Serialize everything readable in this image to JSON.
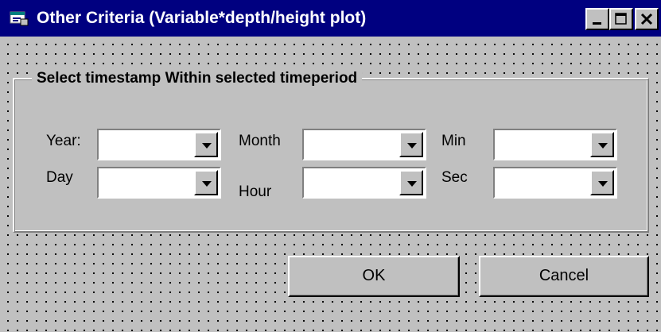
{
  "window": {
    "title": "Other Criteria (Variable*depth/height plot)",
    "icon": "form-icon",
    "controls": [
      "minimize-icon",
      "maximize-icon",
      "close-icon"
    ]
  },
  "frame": {
    "legend": "Select timestamp Within selected timeperiod"
  },
  "fields": {
    "year": {
      "label": "Year:",
      "value": ""
    },
    "day": {
      "label": "Day",
      "value": ""
    },
    "month": {
      "label": "Month",
      "value": ""
    },
    "hour": {
      "label": "Hour",
      "value": ""
    },
    "min": {
      "label": "Min",
      "value": ""
    },
    "sec": {
      "label": "Sec",
      "value": ""
    }
  },
  "buttons": {
    "ok": "OK",
    "cancel": "Cancel"
  },
  "colors": {
    "face": "#c0c0c0",
    "titlebar": "#000080",
    "highlight": "#ffffff",
    "shadow": "#808080"
  }
}
